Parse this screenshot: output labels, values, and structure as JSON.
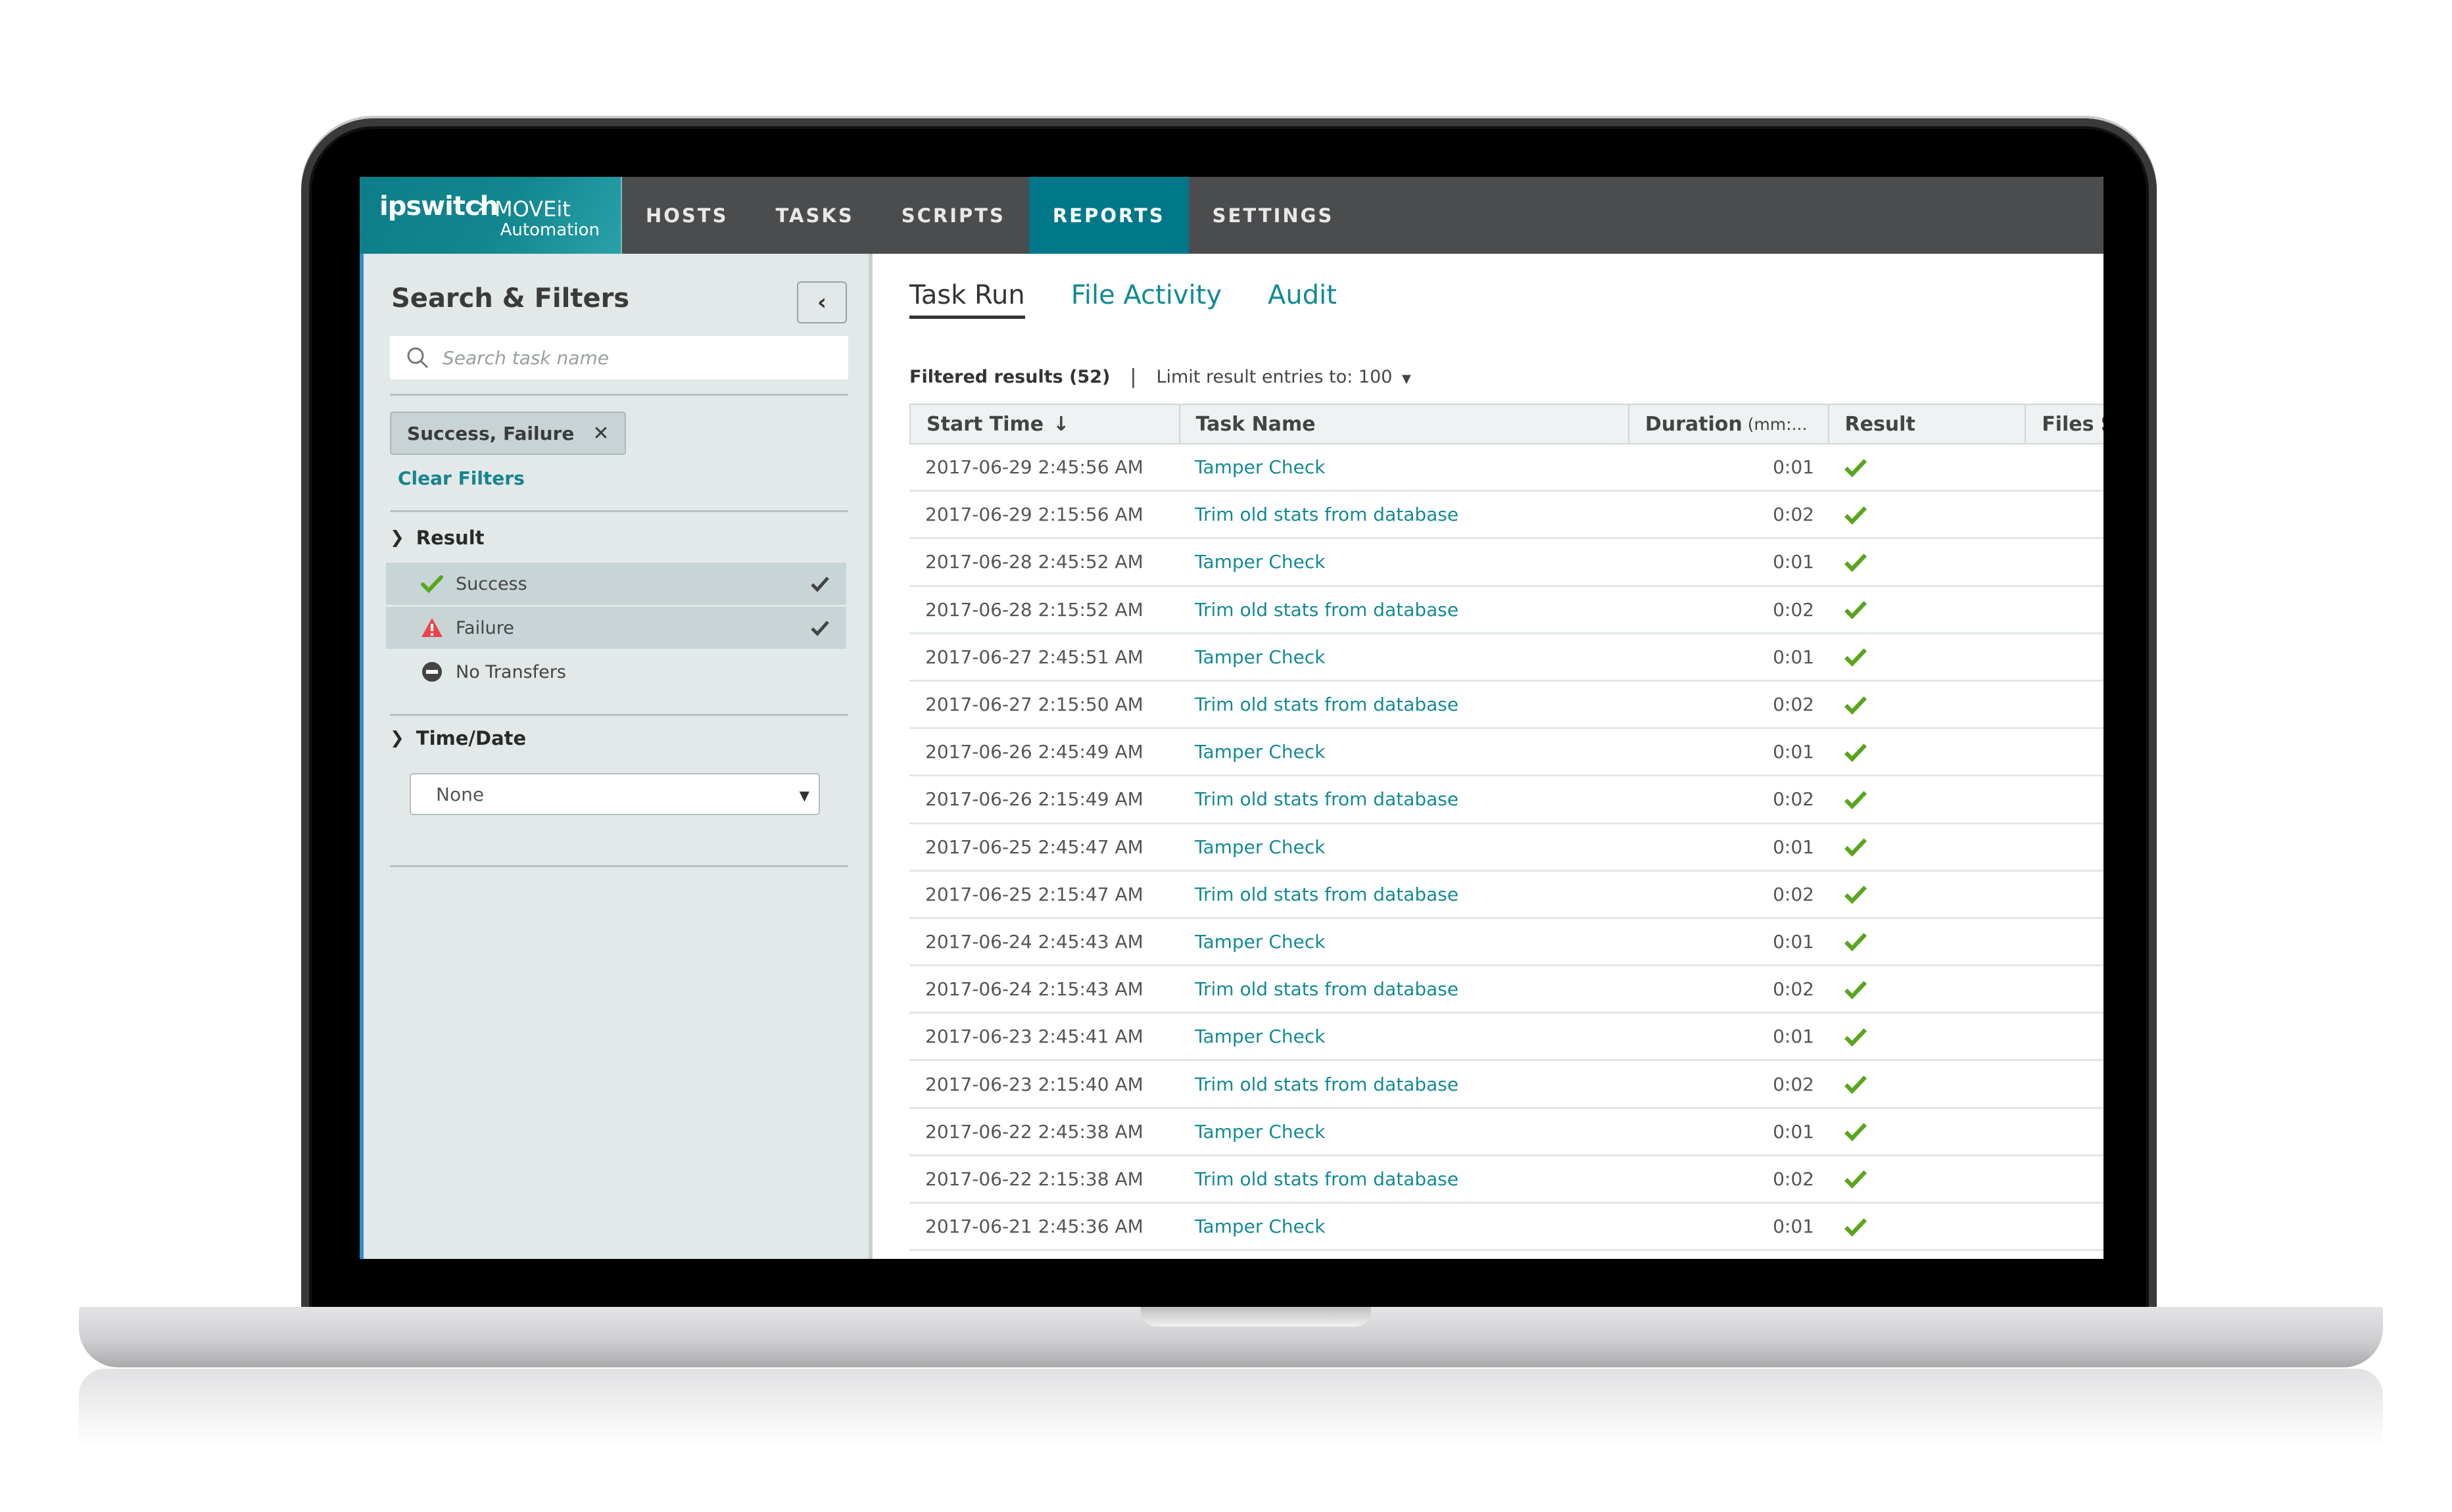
{
  "app": {
    "brand": "ipswitch",
    "product": "MOVEit",
    "product_sub": "Automation"
  },
  "nav": {
    "items": [
      {
        "label": "HOSTS",
        "active": false
      },
      {
        "label": "TASKS",
        "active": false
      },
      {
        "label": "SCRIPTS",
        "active": false
      },
      {
        "label": "REPORTS",
        "active": true
      },
      {
        "label": "SETTINGS",
        "active": false
      }
    ]
  },
  "sidebar": {
    "title": "Search & Filters",
    "collapse_icon": "chevron-left-icon",
    "search_placeholder": "Search task name",
    "search_value": "",
    "active_filter_chip": "Success, Failure",
    "clear_filters": "Clear Filters",
    "result_section": {
      "label": "Result",
      "options": [
        {
          "label": "Success",
          "icon": "success-check-icon",
          "selected": true
        },
        {
          "label": "Failure",
          "icon": "warning-triangle-icon",
          "selected": true
        },
        {
          "label": "No Transfers",
          "icon": "no-entry-icon",
          "selected": false
        }
      ]
    },
    "time_section": {
      "label": "Time/Date",
      "selected": "None"
    }
  },
  "main": {
    "tabs": [
      {
        "label": "Task Run",
        "active": true
      },
      {
        "label": "File Activity",
        "active": false
      },
      {
        "label": "Audit",
        "active": false
      }
    ],
    "filtered_results": "Filtered results (52)",
    "separator": "|",
    "limit_label": "Limit result entries to: 100",
    "columns": [
      {
        "label": "Start Time",
        "sort": "descending"
      },
      {
        "label": "Task Name"
      },
      {
        "label": "Duration",
        "unit": "(mm:..."
      },
      {
        "label": "Result"
      },
      {
        "label": "Files S"
      }
    ],
    "rows": [
      {
        "start": "2017-06-29 2:45:56 AM",
        "task": "Tamper Check",
        "duration": "0:01",
        "result": "success"
      },
      {
        "start": "2017-06-29 2:15:56 AM",
        "task": "Trim old stats from database",
        "duration": "0:02",
        "result": "success"
      },
      {
        "start": "2017-06-28 2:45:52 AM",
        "task": "Tamper Check",
        "duration": "0:01",
        "result": "success"
      },
      {
        "start": "2017-06-28 2:15:52 AM",
        "task": "Trim old stats from database",
        "duration": "0:02",
        "result": "success"
      },
      {
        "start": "2017-06-27 2:45:51 AM",
        "task": "Tamper Check",
        "duration": "0:01",
        "result": "success"
      },
      {
        "start": "2017-06-27 2:15:50 AM",
        "task": "Trim old stats from database",
        "duration": "0:02",
        "result": "success"
      },
      {
        "start": "2017-06-26 2:45:49 AM",
        "task": "Tamper Check",
        "duration": "0:01",
        "result": "success"
      },
      {
        "start": "2017-06-26 2:15:49 AM",
        "task": "Trim old stats from database",
        "duration": "0:02",
        "result": "success"
      },
      {
        "start": "2017-06-25 2:45:47 AM",
        "task": "Tamper Check",
        "duration": "0:01",
        "result": "success"
      },
      {
        "start": "2017-06-25 2:15:47 AM",
        "task": "Trim old stats from database",
        "duration": "0:02",
        "result": "success"
      },
      {
        "start": "2017-06-24 2:45:43 AM",
        "task": "Tamper Check",
        "duration": "0:01",
        "result": "success"
      },
      {
        "start": "2017-06-24 2:15:43 AM",
        "task": "Trim old stats from database",
        "duration": "0:02",
        "result": "success"
      },
      {
        "start": "2017-06-23 2:45:41 AM",
        "task": "Tamper Check",
        "duration": "0:01",
        "result": "success"
      },
      {
        "start": "2017-06-23 2:15:40 AM",
        "task": "Trim old stats from database",
        "duration": "0:02",
        "result": "success"
      },
      {
        "start": "2017-06-22 2:45:38 AM",
        "task": "Tamper Check",
        "duration": "0:01",
        "result": "success"
      },
      {
        "start": "2017-06-22 2:15:38 AM",
        "task": "Trim old stats from database",
        "duration": "0:02",
        "result": "success"
      },
      {
        "start": "2017-06-21 2:45:36 AM",
        "task": "Tamper Check",
        "duration": "0:01",
        "result": "success"
      }
    ]
  },
  "colors": {
    "accent_teal": "#00788a",
    "link_teal": "#138a95",
    "nav_bg": "#4b4c4e",
    "sidebar_bg": "#e3e8e8",
    "success_green": "#5aa51e",
    "failure_red": "#e8474a"
  }
}
